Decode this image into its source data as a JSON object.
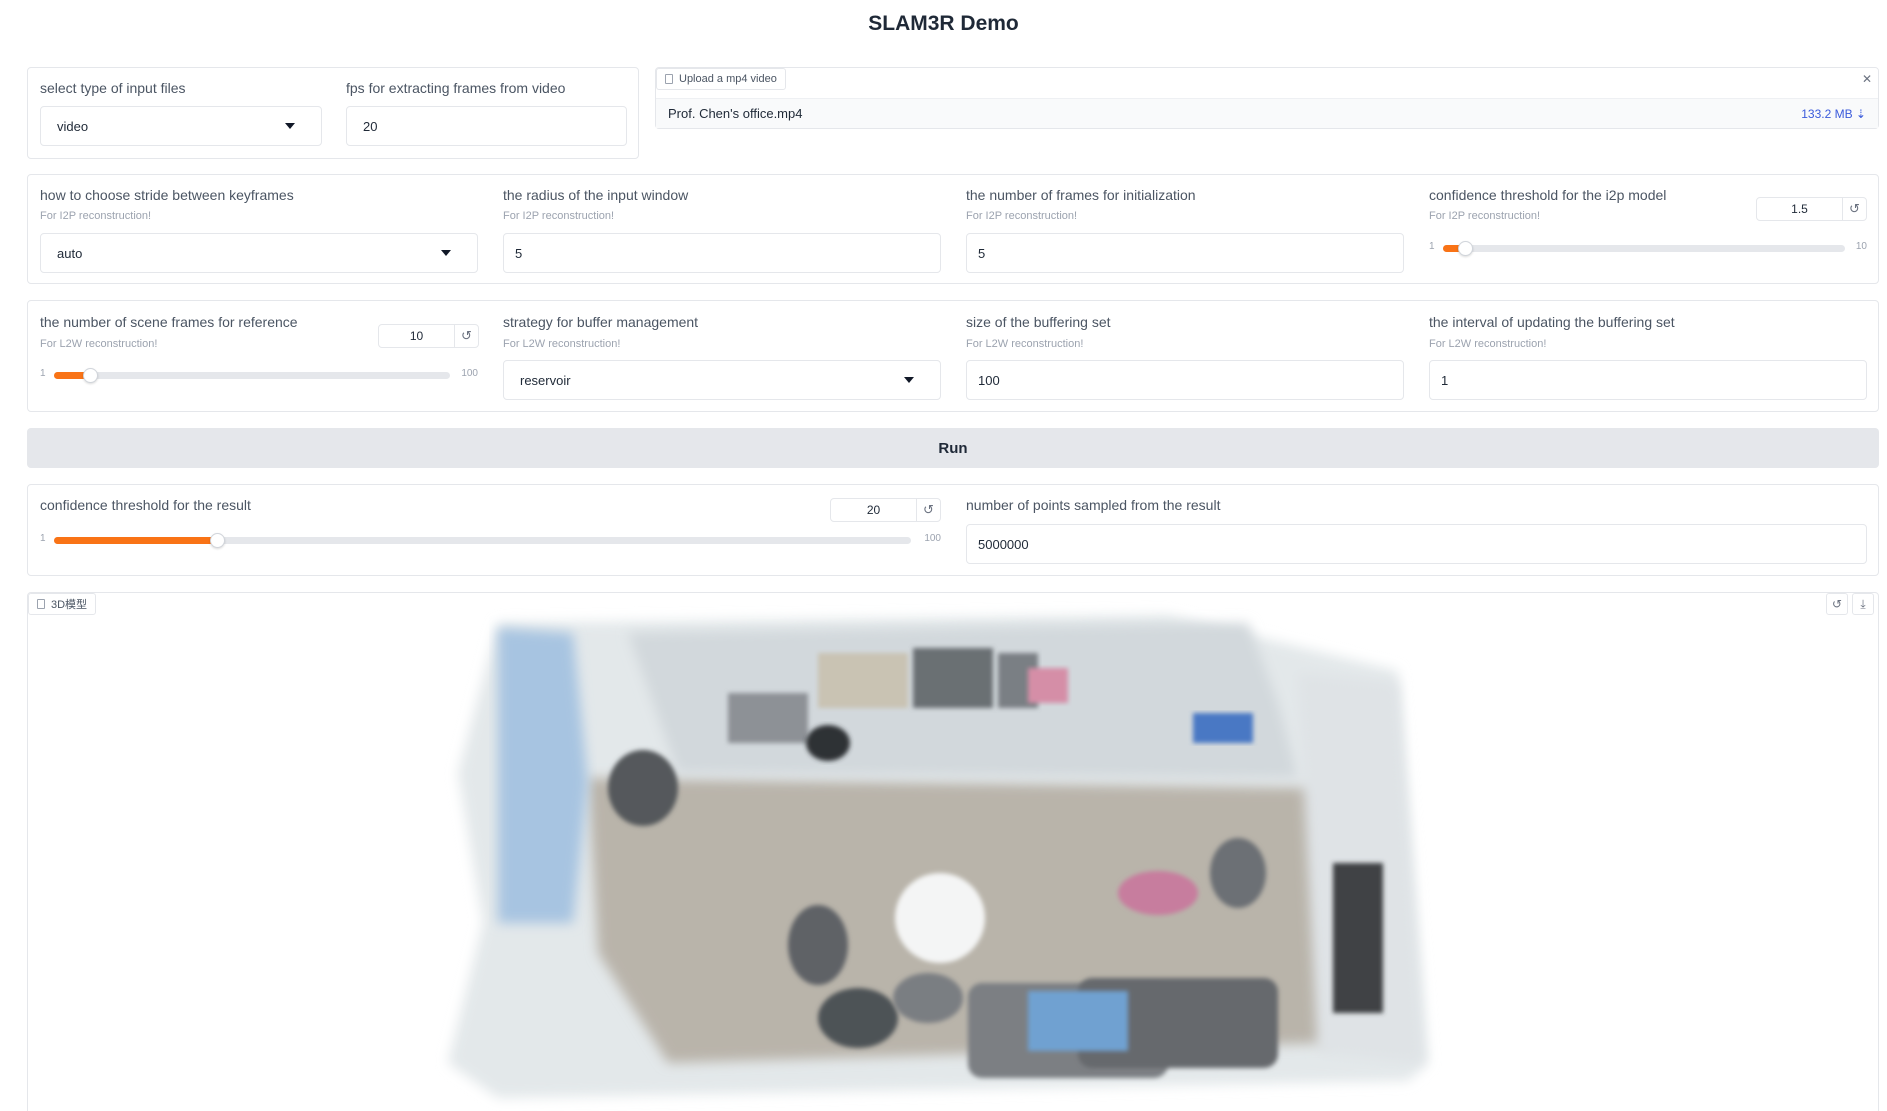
{
  "page": {
    "title": "SLAM3R Demo"
  },
  "input": {
    "type_label": "select type of input files",
    "type_value": "video",
    "fps_label": "fps for extracting frames from video",
    "fps_value": "20"
  },
  "upload": {
    "chip_label": "Upload a mp4 video",
    "file_name": "Prof. Chen's office.mp4",
    "file_size": "133.2 MB ⇣",
    "close_glyph": "✕"
  },
  "i2p": {
    "stride_label": "how to choose stride between keyframes",
    "stride_info": "For I2P reconstruction!",
    "stride_value": "auto",
    "radius_label": "the radius of the input window",
    "radius_info": "For I2P reconstruction!",
    "radius_value": "5",
    "init_label": "the number of frames for initialization",
    "init_info": "For I2P reconstruction!",
    "init_value": "5",
    "conf_label": "confidence threshold for the i2p model",
    "conf_info": "For I2P reconstruction!",
    "conf_value": "1.5",
    "conf_min": "1",
    "conf_max": "10",
    "conf_fraction": 0.055
  },
  "l2w": {
    "ref_label": "the number of scene frames for reference",
    "ref_info": "For L2W reconstruction!",
    "ref_value": "10",
    "ref_min": "1",
    "ref_max": "100",
    "ref_fraction": 0.09,
    "strategy_label": "strategy for buffer management",
    "strategy_info": "For L2W reconstruction!",
    "strategy_value": "reservoir",
    "size_label": "size of the buffering set",
    "size_info": "For L2W reconstruction!",
    "size_value": "100",
    "interval_label": "the interval of updating the buffering set",
    "interval_info": "For L2W reconstruction!",
    "interval_value": "1"
  },
  "run": {
    "label": "Run"
  },
  "result": {
    "conf_label": "confidence threshold for the result",
    "conf_value": "20",
    "conf_min": "1",
    "conf_max": "100",
    "conf_fraction": 0.19,
    "points_label": "number of points sampled from the result",
    "points_value": "5000000"
  },
  "model3d": {
    "chip_label": "3D模型"
  },
  "icons": {
    "reset": "↺",
    "download": "⤓"
  },
  "colors": {
    "accent": "#f97316",
    "run_bg": "#e5e7eb",
    "link": "#3b5bdb"
  }
}
